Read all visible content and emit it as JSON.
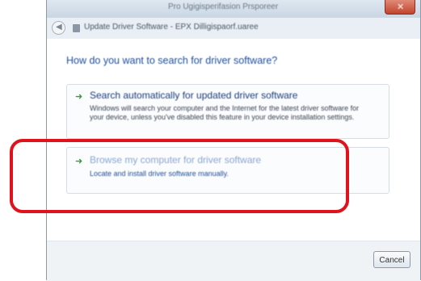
{
  "window": {
    "title": "Pro Ugigisperifasion Prsporeer",
    "close_glyph": "✕"
  },
  "navbar": {
    "back_glyph": "◀",
    "title": "Update Driver Software - EPX Dilligispaorf.uaree"
  },
  "dialog": {
    "heading": "How do you want to search for driver software?",
    "options": [
      {
        "icon": "green-arrow-icon",
        "title": "Search automatically for updated driver software",
        "description": "Windows will search your computer and the Internet for the latest driver software for your device, unless you've disabled this feature in your device installation settings."
      },
      {
        "icon": "green-arrow-icon",
        "title": "Browse my computer for driver software",
        "description": "Locate and install driver software manually."
      }
    ]
  },
  "footer": {
    "cancel_label": "Cancel"
  },
  "colors": {
    "annotation_highlight": "#e0121b",
    "heading_blue": "#1e4e9a",
    "arrow_green": "#2f9e3b"
  }
}
